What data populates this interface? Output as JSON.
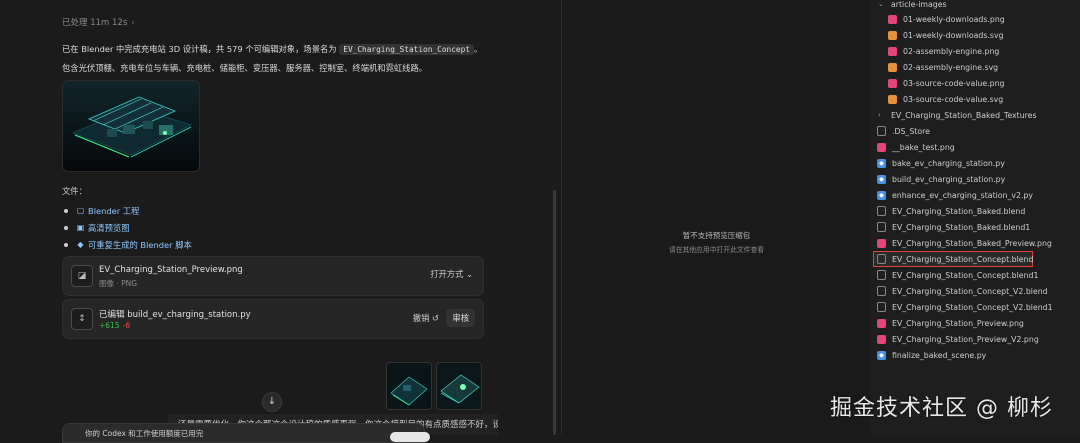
{
  "chat": {
    "processed": "已处理 11m 12s",
    "summary_a": "已在 Blender 中完成充电站 3D 设计稿，共 579 个可编辑对象，场景名为 ",
    "scene_name": "EV_Charging_Station_Concept",
    "summary_b": "。包含光伏顶棚、充电车位与车辆、充电桩、储能柜、变压器、服务器、控制室、终端机和霓虹线路。",
    "files_label": "文件：",
    "links": [
      {
        "label": "Blender 工程",
        "icon": "document-icon"
      },
      {
        "label": "高清预览图",
        "icon": "image-icon"
      },
      {
        "label": "可重复生成的 Blender 脚本",
        "icon": "diamond-icon"
      }
    ],
    "preview_card": {
      "filename": "EV_Charging_Station_Preview.png",
      "subtitle": "图像 · PNG",
      "open_label": "打开方式"
    },
    "edit_card": {
      "title": "已编辑 build_ev_charging_station.py",
      "additions": "+615",
      "deletions": "-6",
      "undo_label": "撤销",
      "review_label": "审核"
    },
    "cut_line": "还是需要优化，你这个那这个设计稿的质感再强，你这个模型目的有点质感感不好，设",
    "toast_text": "你的 Codex 和工作使用额度已用完"
  },
  "preview": {
    "line1": "暂不支持预览压缩包",
    "line2": "请在其他应用中打开此文件查看"
  },
  "tree": {
    "folder": "article-images",
    "sub_items": [
      {
        "name": "01-weekly-downloads.png",
        "type": "img"
      },
      {
        "name": "01-weekly-downloads.svg",
        "type": "svg"
      },
      {
        "name": "02-assembly-engine.png",
        "type": "img"
      },
      {
        "name": "02-assembly-engine.svg",
        "type": "svg"
      },
      {
        "name": "03-source-code-value.png",
        "type": "img"
      },
      {
        "name": "03-source-code-value.svg",
        "type": "svg"
      }
    ],
    "collapsed_folder": "EV_Charging_Station_Baked_Textures",
    "items": [
      {
        "name": ".DS_Store",
        "type": "doc"
      },
      {
        "name": "__bake_test.png",
        "type": "img"
      },
      {
        "name": "bake_ev_charging_station.py",
        "type": "py"
      },
      {
        "name": "build_ev_charging_station.py",
        "type": "py"
      },
      {
        "name": "enhance_ev_charging_station_v2.py",
        "type": "py"
      },
      {
        "name": "EV_Charging_Station_Baked.blend",
        "type": "doc"
      },
      {
        "name": "EV_Charging_Station_Baked.blend1",
        "type": "doc"
      },
      {
        "name": "EV_Charging_Station_Baked_Preview.png",
        "type": "img"
      },
      {
        "name": "EV_Charging_Station_Concept.blend",
        "type": "doc",
        "selected": true
      },
      {
        "name": "EV_Charging_Station_Concept.blend1",
        "type": "doc"
      },
      {
        "name": "EV_Charging_Station_Concept_V2.blend",
        "type": "doc"
      },
      {
        "name": "EV_Charging_Station_Concept_V2.blend1",
        "type": "doc"
      },
      {
        "name": "EV_Charging_Station_Preview.png",
        "type": "img"
      },
      {
        "name": "EV_Charging_Station_Preview_V2.png",
        "type": "img"
      },
      {
        "name": "finalize_baked_scene.py",
        "type": "py"
      }
    ]
  },
  "watermark": "掘金技术社区 @ 柳杉",
  "colors": {
    "accent_link": "#8ec8ff",
    "add": "#3fb950",
    "del": "#f85149",
    "selected_border": "#e0413a"
  }
}
